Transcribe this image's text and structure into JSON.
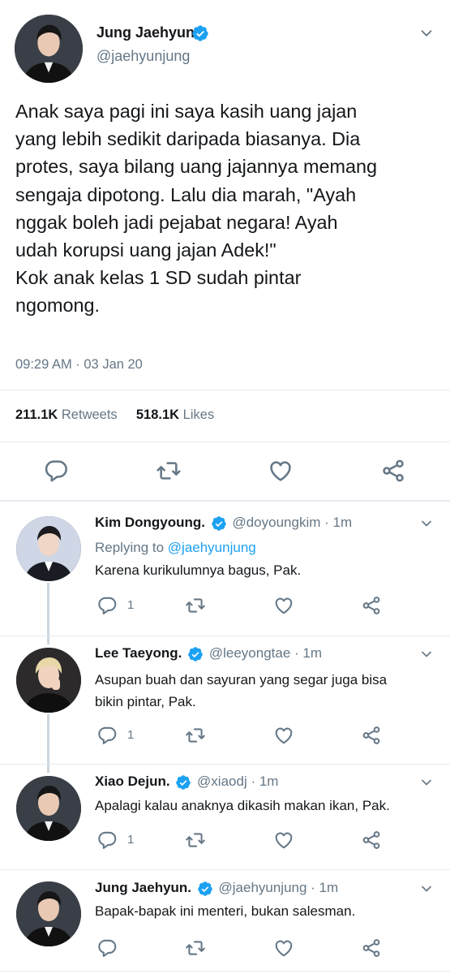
{
  "colors": {
    "accent": "#1da1f2",
    "muted": "#657786",
    "text": "#14171a",
    "divider": "#e6ecf0"
  },
  "main_tweet": {
    "name": "Jung Jaehyun.",
    "handle": "@jaehyunjung",
    "text_lines": [
      "Anak saya pagi ini saya kasih uang jajan",
      "yang lebih sedikit daripada biasanya. Dia",
      "protes, saya bilang uang jajannya memang",
      "sengaja dipotong. Lalu dia marah, \"Ayah",
      "nggak boleh jadi pejabat negara! Ayah",
      "udah korupsi uang jajan Adek!\"",
      "Kok anak kelas 1 SD sudah pintar",
      "ngomong."
    ],
    "timestamp": "09:29 AM · 03 Jan 20",
    "retweets_count": "211.1K",
    "retweets_label": "Retweets",
    "likes_count": "518.1K",
    "likes_label": "Likes",
    "icons": [
      "reply-icon",
      "retweet-icon",
      "like-icon",
      "share-icon"
    ]
  },
  "replies": [
    {
      "name": "Kim Dongyoung.",
      "handle": "@doyoungkim · 1m",
      "replying_prefix": "Replying to ",
      "replying_to": "@jaehyunjung",
      "text": "Karena kurikulumnya bagus, Pak.",
      "reply_count": "1"
    },
    {
      "name": "Lee Taeyong.",
      "handle": "@leeyongtae · 1m",
      "text_lines": [
        "Asupan buah dan sayuran yang segar juga bisa",
        "bikin pintar, Pak."
      ],
      "reply_count": "1"
    },
    {
      "name": "Xiao Dejun.",
      "handle": "@xiaodj · 1m",
      "text": "Apalagi kalau anaknya dikasih makan ikan, Pak.",
      "reply_count": "1"
    },
    {
      "name": "Jung Jaehyun.",
      "handle": "@jaehyunjung · 1m",
      "text": "Bapak-bapak ini menteri, bukan salesman."
    }
  ]
}
